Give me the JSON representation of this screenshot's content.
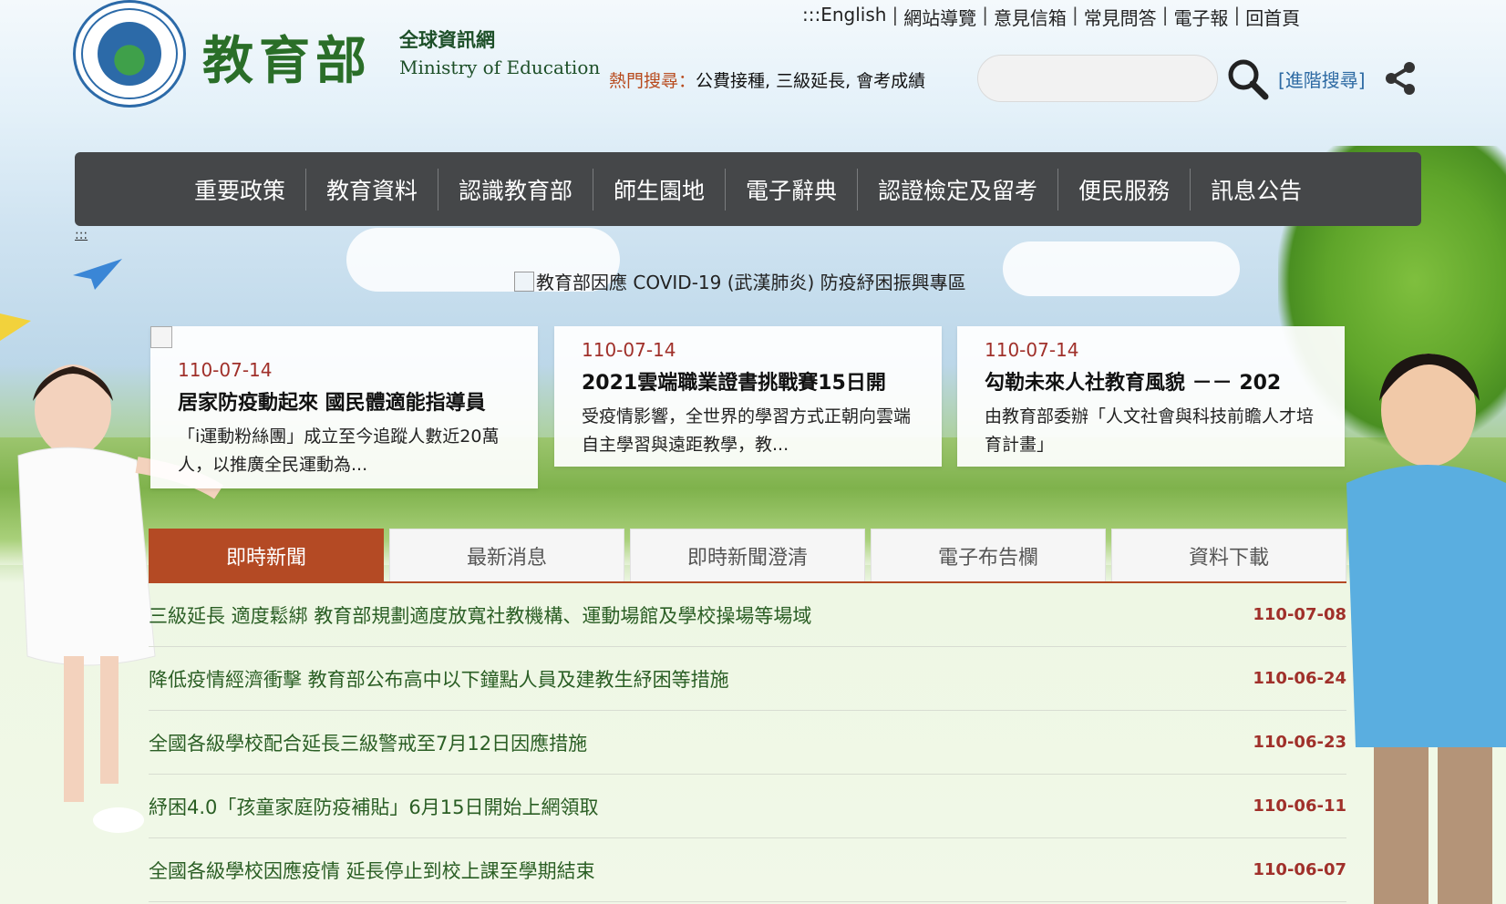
{
  "header": {
    "logo_cn": "教育部",
    "logo_sub_cn": "全球資訊網",
    "logo_sub_en": "Ministry of Education",
    "logo_ring_text": "MINISTRY OF EDUCATION",
    "top_links": [
      ":::English",
      "網站導覽",
      "意見信箱",
      "常見問答",
      "電子報",
      "回首頁"
    ],
    "hot_label": "熱門搜尋：",
    "hot_terms": "公費接種, 三級延長, 會考成績",
    "search_placeholder": "",
    "advanced_search": "[進階搜尋]"
  },
  "nav": {
    "items": [
      "重要政策",
      "教育資料",
      "認識教育部",
      "師生園地",
      "電子辭典",
      "認證檢定及留考",
      "便民服務",
      "訊息公告"
    ],
    "accesskey": ":::"
  },
  "banner": {
    "covid_link": "教育部因應 COVID-19 (武漢肺炎) 防疫紓困振興專區"
  },
  "cards": [
    {
      "date": "110-07-14",
      "title": "居家防疫動起來 國民體適能指導員",
      "desc": "「i運動粉絲團」成立至今追蹤人數近20萬人，以推廣全民運動為..."
    },
    {
      "date": "110-07-14",
      "title": "2021雲端職業證書挑戰賽15日開",
      "desc": "受疫情影響，全世界的學習方式正朝向雲端自主學習與遠距教學，教..."
    },
    {
      "date": "110-07-14",
      "title": "勾勒未來人社教育風貌 －－ 202",
      "desc": "由教育部委辦「人文社會與科技前瞻人才培育計畫」"
    }
  ],
  "tabs": [
    "即時新聞",
    "最新消息",
    "即時新聞澄清",
    "電子布告欄",
    "資料下載"
  ],
  "active_tab": 0,
  "news": [
    {
      "title": "三級延長 適度鬆綁 教育部規劃適度放寬社教機構、運動場館及學校操場等場域",
      "date": "110-07-08"
    },
    {
      "title": "降低疫情經濟衝擊 教育部公布高中以下鐘點人員及建教生紓困等措施",
      "date": "110-06-24"
    },
    {
      "title": "全國各級學校配合延長三級警戒至7月12日因應措施",
      "date": "110-06-23"
    },
    {
      "title": "紓困4.0「孩童家庭防疫補貼」6月15日開始上網領取",
      "date": "110-06-11"
    },
    {
      "title": "全國各級學校因應疫情 延長停止到校上課至學期結束",
      "date": "110-06-07"
    }
  ],
  "colors": {
    "nav_bg": "#454749",
    "tab_active": "#b44a24",
    "date_red": "#a0302a",
    "news_green": "#2a5e24",
    "logo_green": "#2a6e28",
    "link_blue": "#2d6aa3"
  }
}
